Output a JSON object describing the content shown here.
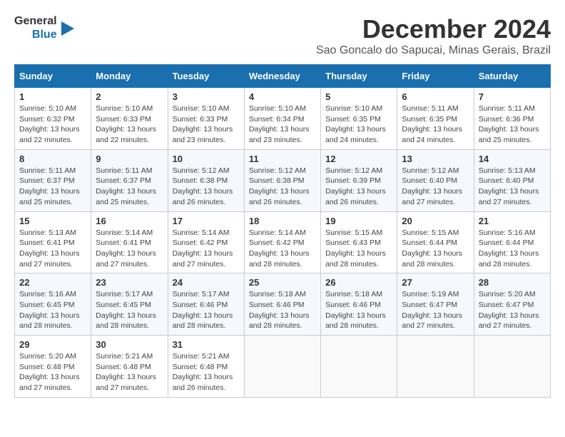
{
  "logo": {
    "line1": "General",
    "line2": "Blue"
  },
  "title": "December 2024",
  "location": "Sao Goncalo do Sapucai, Minas Gerais, Brazil",
  "days_of_week": [
    "Sunday",
    "Monday",
    "Tuesday",
    "Wednesday",
    "Thursday",
    "Friday",
    "Saturday"
  ],
  "weeks": [
    [
      {
        "day": "1",
        "sunrise": "5:10 AM",
        "sunset": "6:32 PM",
        "daylight": "13 hours and 22 minutes."
      },
      {
        "day": "2",
        "sunrise": "5:10 AM",
        "sunset": "6:33 PM",
        "daylight": "13 hours and 22 minutes."
      },
      {
        "day": "3",
        "sunrise": "5:10 AM",
        "sunset": "6:33 PM",
        "daylight": "13 hours and 23 minutes."
      },
      {
        "day": "4",
        "sunrise": "5:10 AM",
        "sunset": "6:34 PM",
        "daylight": "13 hours and 23 minutes."
      },
      {
        "day": "5",
        "sunrise": "5:10 AM",
        "sunset": "6:35 PM",
        "daylight": "13 hours and 24 minutes."
      },
      {
        "day": "6",
        "sunrise": "5:11 AM",
        "sunset": "6:35 PM",
        "daylight": "13 hours and 24 minutes."
      },
      {
        "day": "7",
        "sunrise": "5:11 AM",
        "sunset": "6:36 PM",
        "daylight": "13 hours and 25 minutes."
      }
    ],
    [
      {
        "day": "8",
        "sunrise": "5:11 AM",
        "sunset": "6:37 PM",
        "daylight": "13 hours and 25 minutes."
      },
      {
        "day": "9",
        "sunrise": "5:11 AM",
        "sunset": "6:37 PM",
        "daylight": "13 hours and 25 minutes."
      },
      {
        "day": "10",
        "sunrise": "5:12 AM",
        "sunset": "6:38 PM",
        "daylight": "13 hours and 26 minutes."
      },
      {
        "day": "11",
        "sunrise": "5:12 AM",
        "sunset": "6:38 PM",
        "daylight": "13 hours and 26 minutes."
      },
      {
        "day": "12",
        "sunrise": "5:12 AM",
        "sunset": "6:39 PM",
        "daylight": "13 hours and 26 minutes."
      },
      {
        "day": "13",
        "sunrise": "5:12 AM",
        "sunset": "6:40 PM",
        "daylight": "13 hours and 27 minutes."
      },
      {
        "day": "14",
        "sunrise": "5:13 AM",
        "sunset": "6:40 PM",
        "daylight": "13 hours and 27 minutes."
      }
    ],
    [
      {
        "day": "15",
        "sunrise": "5:13 AM",
        "sunset": "6:41 PM",
        "daylight": "13 hours and 27 minutes."
      },
      {
        "day": "16",
        "sunrise": "5:14 AM",
        "sunset": "6:41 PM",
        "daylight": "13 hours and 27 minutes."
      },
      {
        "day": "17",
        "sunrise": "5:14 AM",
        "sunset": "6:42 PM",
        "daylight": "13 hours and 27 minutes."
      },
      {
        "day": "18",
        "sunrise": "5:14 AM",
        "sunset": "6:42 PM",
        "daylight": "13 hours and 28 minutes."
      },
      {
        "day": "19",
        "sunrise": "5:15 AM",
        "sunset": "6:43 PM",
        "daylight": "13 hours and 28 minutes."
      },
      {
        "day": "20",
        "sunrise": "5:15 AM",
        "sunset": "6:44 PM",
        "daylight": "13 hours and 28 minutes."
      },
      {
        "day": "21",
        "sunrise": "5:16 AM",
        "sunset": "6:44 PM",
        "daylight": "13 hours and 28 minutes."
      }
    ],
    [
      {
        "day": "22",
        "sunrise": "5:16 AM",
        "sunset": "6:45 PM",
        "daylight": "13 hours and 28 minutes."
      },
      {
        "day": "23",
        "sunrise": "5:17 AM",
        "sunset": "6:45 PM",
        "daylight": "13 hours and 28 minutes."
      },
      {
        "day": "24",
        "sunrise": "5:17 AM",
        "sunset": "6:46 PM",
        "daylight": "13 hours and 28 minutes."
      },
      {
        "day": "25",
        "sunrise": "5:18 AM",
        "sunset": "6:46 PM",
        "daylight": "13 hours and 28 minutes."
      },
      {
        "day": "26",
        "sunrise": "5:18 AM",
        "sunset": "6:46 PM",
        "daylight": "13 hours and 28 minutes."
      },
      {
        "day": "27",
        "sunrise": "5:19 AM",
        "sunset": "6:47 PM",
        "daylight": "13 hours and 27 minutes."
      },
      {
        "day": "28",
        "sunrise": "5:20 AM",
        "sunset": "6:47 PM",
        "daylight": "13 hours and 27 minutes."
      }
    ],
    [
      {
        "day": "29",
        "sunrise": "5:20 AM",
        "sunset": "6:48 PM",
        "daylight": "13 hours and 27 minutes."
      },
      {
        "day": "30",
        "sunrise": "5:21 AM",
        "sunset": "6:48 PM",
        "daylight": "13 hours and 27 minutes."
      },
      {
        "day": "31",
        "sunrise": "5:21 AM",
        "sunset": "6:48 PM",
        "daylight": "13 hours and 26 minutes."
      },
      null,
      null,
      null,
      null
    ]
  ]
}
